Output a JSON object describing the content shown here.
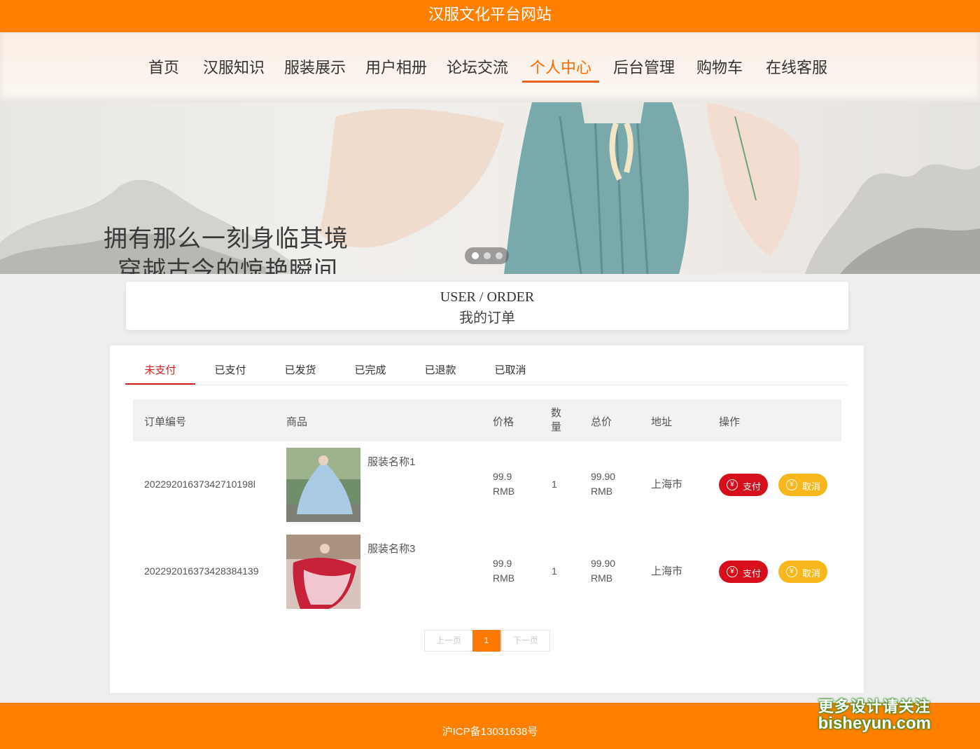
{
  "site": {
    "title": "汉服文化平台网站"
  },
  "nav": [
    "首页",
    "汉服知识",
    "服装展示",
    "用户相册",
    "论坛交流",
    "个人中心",
    "后台管理",
    "购物车",
    "在线客服"
  ],
  "banner": {
    "line1": "拥有那么一刻身临其境",
    "line2": "穿越古今的惊艳瞬间"
  },
  "section": {
    "title_en": "USER / ORDER",
    "title_cn": "我的订单"
  },
  "tabs": [
    "未支付",
    "已支付",
    "已发货",
    "已完成",
    "已退款",
    "已取消"
  ],
  "table": {
    "headers": {
      "order_no": "订单编号",
      "goods": "商品",
      "price": "价格",
      "qty": "数量",
      "total": "总价",
      "address": "地址",
      "action": "操作"
    },
    "rows": [
      {
        "order_no": "20229201637342710198l",
        "name": "服装名称1",
        "price": "99.9",
        "price_unit": "RMB",
        "qty": "1",
        "total": "99.90",
        "total_unit": "RMB",
        "address": "上海市",
        "pay": "支付",
        "cancel": "取消"
      },
      {
        "order_no": "202292016373428384139",
        "name": "服装名称3",
        "price": "99.9",
        "price_unit": "RMB",
        "qty": "1",
        "total": "99.90",
        "total_unit": "RMB",
        "address": "上海市",
        "pay": "支付",
        "cancel": "取消"
      }
    ]
  },
  "pagination": {
    "prev": "上一页",
    "current": "1",
    "next": "下一页"
  },
  "footer": {
    "icp": "沪ICP备13031638号"
  },
  "watermark": {
    "line1": "更多设计请关注",
    "line2": "bisheyun.com"
  },
  "icons": {
    "pay": "yuan-circle-icon",
    "cancel": "yuan-circle-icon"
  },
  "colors": {
    "brand": "#ff7f00",
    "active_tab": "#d11e1e",
    "pay_button": "#d60f1a",
    "cancel_button": "#f8b81d"
  }
}
